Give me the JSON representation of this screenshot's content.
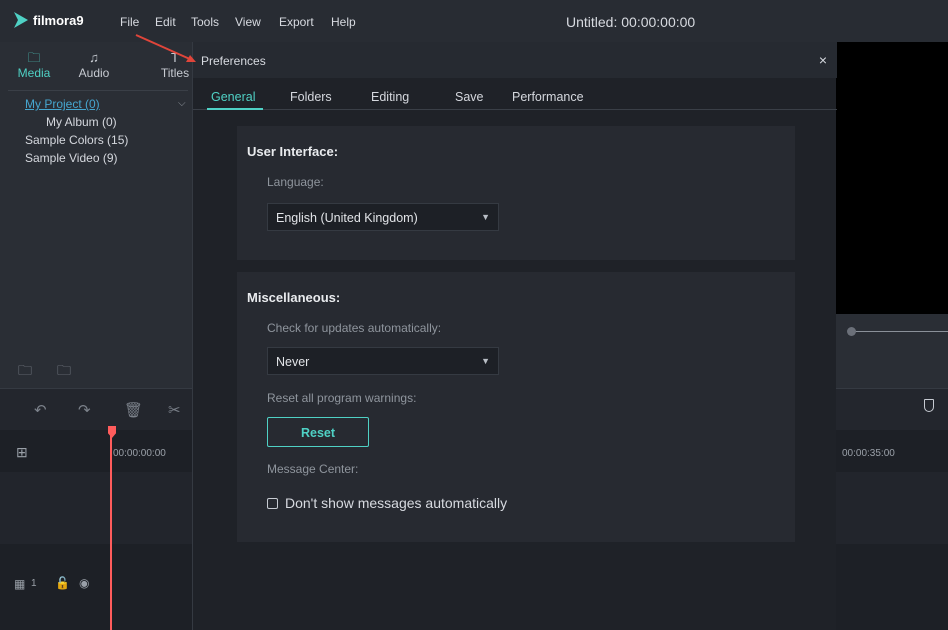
{
  "app": {
    "logo_text": "filmora9",
    "menu": [
      "File",
      "Edit",
      "Tools",
      "View",
      "Export",
      "Help"
    ],
    "window_title": "Untitled: 00:00:00:00"
  },
  "media_panel": {
    "tabs": [
      {
        "label": "Media",
        "icon": "folder-icon",
        "active": true
      },
      {
        "label": "Audio",
        "icon": "music-note-icon",
        "active": false
      },
      {
        "label": "Titles",
        "icon": "text-icon",
        "active": false
      }
    ],
    "tree": [
      {
        "label": "My Project (0)",
        "selected": true
      },
      {
        "label": "My Album (0)",
        "selected": false
      },
      {
        "label": "Sample Colors (15)",
        "selected": false
      },
      {
        "label": "Sample Video (9)",
        "selected": false
      }
    ]
  },
  "timeline": {
    "start_timecode": "00:00:00:00",
    "right_timecode": "00:00:35:00",
    "track_label": "1"
  },
  "dialog": {
    "title": "Preferences",
    "close_label": "×",
    "tabs": [
      "General",
      "Folders",
      "Editing",
      "Save",
      "Performance"
    ],
    "active_tab": "General",
    "user_interface": {
      "heading": "User Interface:",
      "language_label": "Language:",
      "language_value": "English (United Kingdom)"
    },
    "misc": {
      "heading": "Miscellaneous:",
      "updates_label": "Check for updates automatically:",
      "updates_value": "Never",
      "reset_label": "Reset all program warnings:",
      "reset_button": "Reset",
      "message_center_label": "Message Center:",
      "dont_show_label": "Don't show messages automatically",
      "dont_show_checked": false
    }
  },
  "colors": {
    "accent": "#4fd1c5",
    "annotation_arrow": "#e0453a",
    "playhead": "#ff5c5c"
  }
}
